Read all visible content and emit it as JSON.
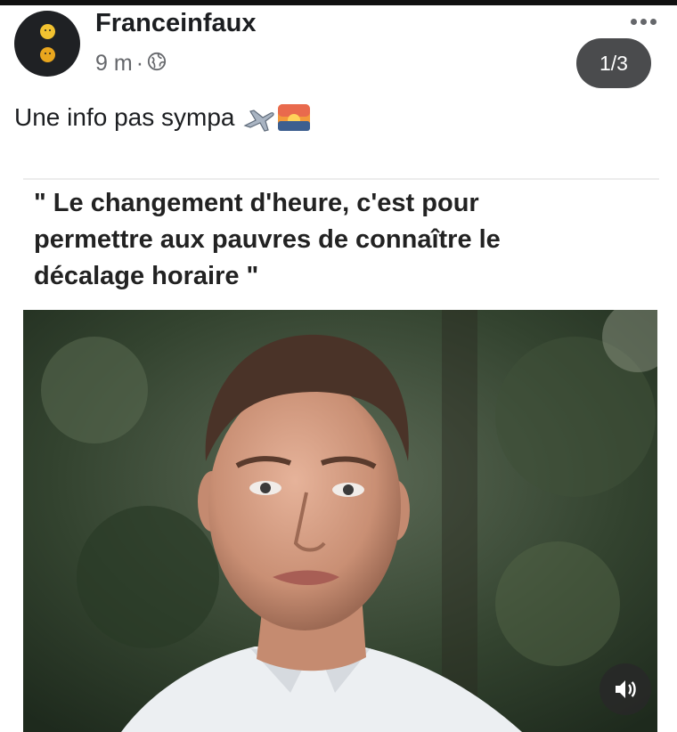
{
  "post": {
    "page_name": "Franceinfaux",
    "time": "9 m",
    "separator": "·",
    "privacy_icon": "globe-icon",
    "caption": "Une info pas sympa",
    "caption_emojis": [
      "airplane-icon",
      "sunset-icon"
    ],
    "page_indicator": "1/3",
    "more_icon": "ellipsis-icon",
    "sound_icon": "speaker-icon"
  },
  "card": {
    "quote_lines": [
      "\" Le changement d'heure, c'est pour",
      "permettre aux pauvres de connaître le",
      "décalage horaire \""
    ]
  },
  "colors": {
    "text": "#1c1e21",
    "meta": "#65676b",
    "indicator_bg": "#4a4b4d",
    "avatar_bg": "#1f2124",
    "avatar_dot": "#f2c230"
  }
}
